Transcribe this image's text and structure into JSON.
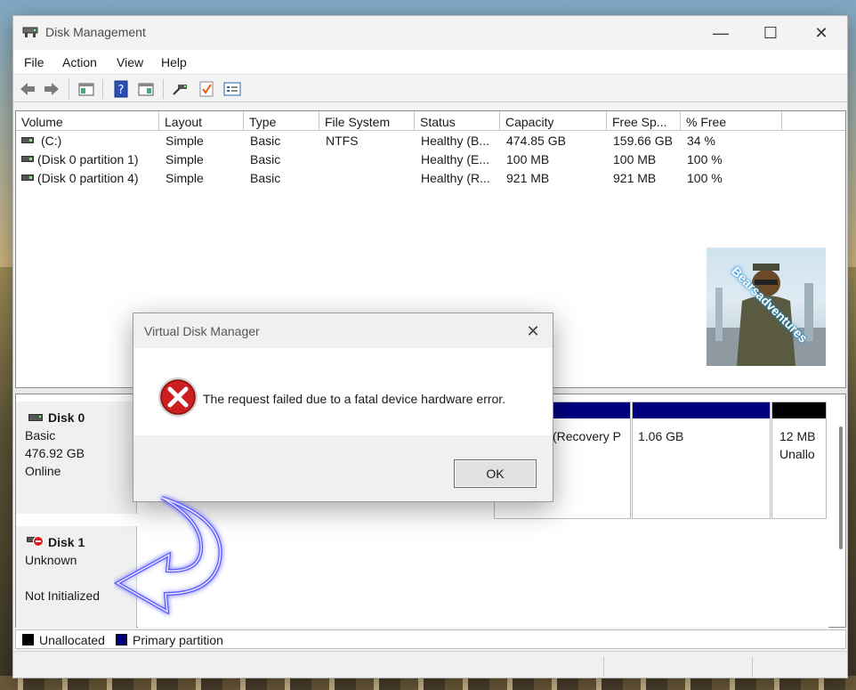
{
  "window": {
    "title": "Disk Management",
    "minimize_glyph": "—",
    "maximize_glyph": "☐",
    "close_glyph": "✕"
  },
  "menu": [
    "File",
    "Action",
    "View",
    "Help"
  ],
  "toolbar": {
    "icons": [
      "back-icon",
      "forward-icon",
      "show-hide-console-tree-icon",
      "help-icon",
      "properties-icon",
      "connect-icon",
      "check-icon",
      "list-icon"
    ]
  },
  "volume_table": {
    "columns": [
      "Volume",
      "Layout",
      "Type",
      "File System",
      "Status",
      "Capacity",
      "Free Sp...",
      "% Free"
    ],
    "rows": [
      {
        "volume": "(C:)",
        "layout": "Simple",
        "type": "Basic",
        "file_system": "NTFS",
        "status": "Healthy (B...",
        "capacity": "474.85 GB",
        "free": "159.66 GB",
        "pct_free": "34 %"
      },
      {
        "volume": "(Disk 0 partition 1)",
        "layout": "Simple",
        "type": "Basic",
        "file_system": "",
        "status": "Healthy (E...",
        "capacity": "100 MB",
        "free": "100 MB",
        "pct_free": "100 %"
      },
      {
        "volume": "(Disk 0 partition 4)",
        "layout": "Simple",
        "type": "Basic",
        "file_system": "",
        "status": "Healthy (R...",
        "capacity": "921 MB",
        "free": "921 MB",
        "pct_free": "100 %"
      }
    ]
  },
  "disks": [
    {
      "name": "Disk 0",
      "type": "Basic",
      "size": "476.92 GB",
      "state": "Online",
      "partitions": [
        {
          "label": "(Recovery P",
          "color": "#00007f"
        },
        {
          "label": "1.06 GB",
          "color": "#00007f"
        },
        {
          "label1": "12 MB",
          "label2": "Unallo",
          "color": "#000000"
        }
      ]
    },
    {
      "name": "Disk 1",
      "type": "Unknown",
      "state": "Not Initialized"
    }
  ],
  "legend": {
    "unallocated": "Unallocated",
    "primary": "Primary partition",
    "unallocated_color": "#000000",
    "primary_color": "#00007f"
  },
  "watermark": {
    "text": "Bearsadventures"
  },
  "dialog": {
    "title": "Virtual Disk Manager",
    "message": "The request failed due to a fatal device hardware error.",
    "ok_label": "OK",
    "close_glyph": "✕"
  }
}
